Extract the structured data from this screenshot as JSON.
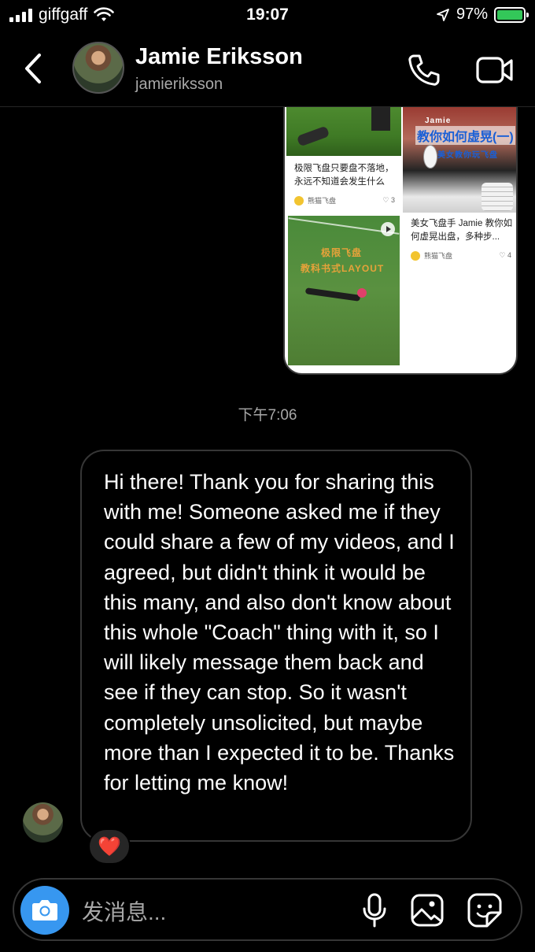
{
  "status_bar": {
    "carrier": "giffgaff",
    "time": "19:07",
    "battery_percent": "97%",
    "icons": [
      "signal-icon",
      "wifi-icon",
      "location-arrow-icon",
      "battery-charging-icon"
    ]
  },
  "header": {
    "name": "Jamie Eriksson",
    "handle": "jamieriksson",
    "icons": [
      "back-chevron-icon",
      "phone-icon",
      "video-camera-icon"
    ]
  },
  "shared_post": {
    "tiles": [
      {
        "caption": "极限飞盘只要盘不落地，永远不知道会发生什么",
        "account": "熊猫飞盘",
        "likes": "3"
      },
      {
        "overlay_top": "Jamie",
        "overlay_title": "教你如何虚晃(一)",
        "overlay_sub": "美女教你玩飞盘"
      },
      {
        "caption": "美女飞盘手 Jamie 教你如何虚晃出盘，多种步...",
        "account": "熊猫飞盘",
        "likes": "4"
      },
      {
        "overlay_line1": "极限飞盘",
        "overlay_line2": "教科书式LAYOUT"
      }
    ]
  },
  "timestamp": "下午7:06",
  "message": {
    "text": "Hi there! Thank you for sharing this with me! Someone asked me if they could share a few of my videos, and I agreed, but didn't think it would be this many, and also don't know about this whole \"Coach\" thing with it, so I will likely message them back and see if they can stop. So it wasn't completely unsolicited, but maybe more than I expected it to be. Thanks for letting me know!",
    "reaction": "❤️"
  },
  "composer": {
    "placeholder": "发消息...",
    "icons": [
      "camera-icon",
      "microphone-icon",
      "gallery-icon",
      "sticker-icon"
    ]
  }
}
